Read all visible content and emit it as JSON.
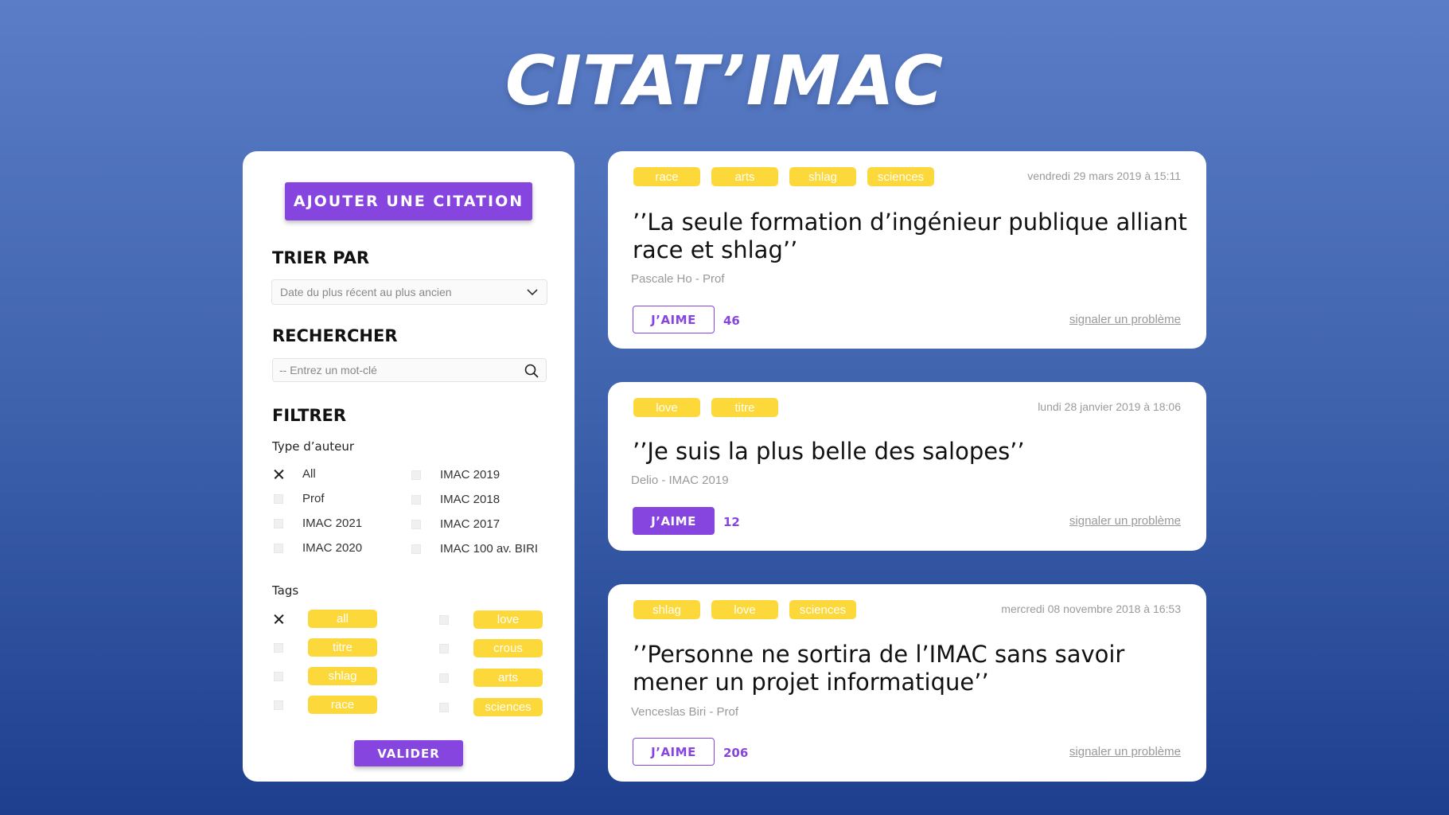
{
  "app": {
    "title": "CITAT’IMAC"
  },
  "sidebar": {
    "add_button": "AJOUTER UNE CITATION",
    "sort": {
      "heading": "TRIER PAR",
      "selected": "Date du plus récent au plus ancien"
    },
    "search": {
      "heading": "RECHERCHER",
      "placeholder": "-- Entrez un mot-clé",
      "value": ""
    },
    "filter": {
      "heading": "FILTRER",
      "author_type": {
        "label": "Type d’auteur",
        "options": [
          {
            "label": "All",
            "checked": true
          },
          {
            "label": "Prof",
            "checked": false
          },
          {
            "label": "IMAC 2021",
            "checked": false
          },
          {
            "label": "IMAC 2020",
            "checked": false
          },
          {
            "label": "IMAC 2019",
            "checked": false
          },
          {
            "label": "IMAC 2018",
            "checked": false
          },
          {
            "label": "IMAC 2017",
            "checked": false
          },
          {
            "label": "IMAC 100 av. BIRI",
            "checked": false
          }
        ]
      },
      "tags": {
        "label": "Tags",
        "options": [
          {
            "label": "all",
            "checked": true
          },
          {
            "label": "titre",
            "checked": false
          },
          {
            "label": "shlag",
            "checked": false
          },
          {
            "label": "race",
            "checked": false
          },
          {
            "label": "love",
            "checked": false
          },
          {
            "label": "crous",
            "checked": false
          },
          {
            "label": "arts",
            "checked": false
          },
          {
            "label": "sciences",
            "checked": false
          }
        ]
      }
    },
    "validate_button": "VALIDER"
  },
  "quotes": [
    {
      "tags": [
        "race",
        "arts",
        "shlag",
        "sciences"
      ],
      "date": "vendredi 29 mars 2019 à 15:11",
      "text": "’’La seule formation d’ingénieur publique alliant race et shlag’’",
      "author": "Pascale Ho - Prof",
      "like_label": "J’AIME",
      "likes": "46",
      "liked": false,
      "report_label": "signaler un problème"
    },
    {
      "tags": [
        "love",
        "titre"
      ],
      "date": "lundi 28 janvier 2019 à 18:06",
      "text": "’’Je suis la plus belle des salopes’’",
      "author": "Delio - IMAC 2019",
      "like_label": "J’AIME",
      "likes": "12",
      "liked": true,
      "report_label": "signaler un problème"
    },
    {
      "tags": [
        "shlag",
        "love",
        "sciences"
      ],
      "date": "mercredi 08 novembre 2018 à 16:53",
      "text": "’’Personne ne sortira de l’IMAC sans savoir mener un projet informatique’’",
      "author": "Venceslas Biri - Prof",
      "like_label": "J’AIME",
      "likes": "206",
      "liked": false,
      "report_label": "signaler un problème"
    }
  ],
  "colors": {
    "accent": "#8645de",
    "tag": "#fcd83a",
    "muted": "#999999"
  },
  "icons": {
    "sort_dropdown": "chevron-down-icon",
    "search": "search-icon",
    "checked": "cross-check-icon"
  }
}
